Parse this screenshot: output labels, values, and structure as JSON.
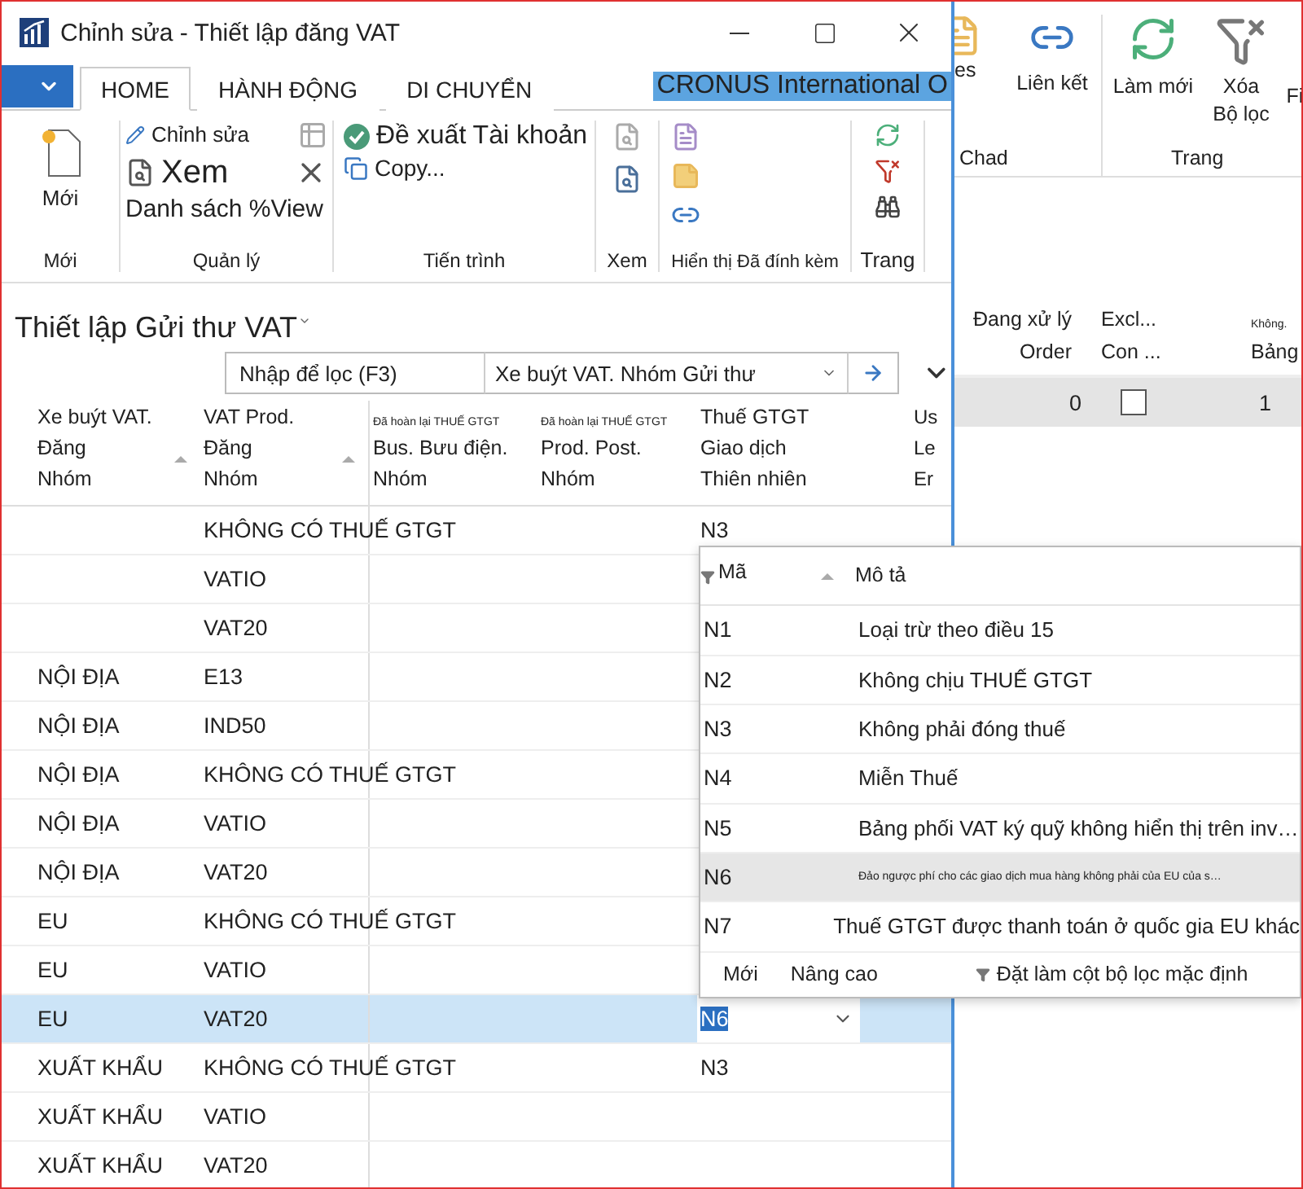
{
  "window": {
    "title": "Chỉnh sửa - Thiết lập đăng VAT"
  },
  "ribbon_tabs": [
    {
      "label": "HOME",
      "selected": true
    },
    {
      "label": "HÀNH ĐỘNG",
      "selected": false
    },
    {
      "label": "DI CHUYỂN",
      "selected": false
    }
  ],
  "company": "CRONUS International O",
  "ribbon": {
    "new": {
      "button": "Mới",
      "group": "Mới"
    },
    "manage": {
      "edit": "Chỉnh sửa",
      "view": "Xem",
      "list": "Danh sách %View",
      "group": "Quản lý"
    },
    "process": {
      "suggest": "Đề xuất Tài khoản",
      "copy": "Copy...",
      "group": "Tiến trình"
    },
    "view_group": "Xem",
    "attachments_group": "Hiển thị Đã đính kèm",
    "page_group": "Trang"
  },
  "page_title": "Thiết lập Gửi thư VAT",
  "filter": {
    "placeholder": "Nhập để lọc (F3)",
    "field": "Xe buýt VAT. Nhóm Gửi thư"
  },
  "columns": [
    {
      "lines": [
        "Xe buýt VAT.",
        "Đăng",
        "Nhóm"
      ],
      "sorted": true
    },
    {
      "lines": [
        "VAT Prod.",
        "Đăng",
        "Nhóm"
      ],
      "sorted": true
    },
    {
      "caption": "Đã hoàn lại THUẾ GTGT",
      "lines": [
        "Bus. Bưu điện.",
        "Nhóm"
      ],
      "sorted": false
    },
    {
      "caption": "Đã hoàn lại THUẾ GTGT",
      "lines": [
        "Prod. Post.",
        "Nhóm"
      ],
      "sorted": false
    },
    {
      "lines": [
        "Thuế GTGT",
        "Giao dịch",
        "Thiên nhiên"
      ],
      "sorted": false
    },
    {
      "lines": [
        "Us",
        "Le",
        "Er"
      ],
      "sorted": false
    }
  ],
  "rows": [
    {
      "bus_group": "",
      "prod_group": "KHÔNG CÓ THUẾ GTGT",
      "vat_nature": "N3",
      "selected": false
    },
    {
      "bus_group": "",
      "prod_group": "VATIO",
      "selected": false
    },
    {
      "bus_group": "",
      "prod_group": "VAT20",
      "selected": false
    },
    {
      "bus_group": "NỘI ĐỊA",
      "prod_group": "E13",
      "selected": false
    },
    {
      "bus_group": "NỘI ĐỊA",
      "prod_group": "IND50",
      "selected": false
    },
    {
      "bus_group": "NỘI ĐỊA",
      "prod_group": "KHÔNG CÓ THUẾ GTGT",
      "selected": false
    },
    {
      "bus_group": "NỘI ĐỊA",
      "prod_group": "VATIO",
      "selected": false
    },
    {
      "bus_group": "NỘI ĐỊA",
      "prod_group": "VAT20",
      "selected": false
    },
    {
      "bus_group": "EU",
      "prod_group": "KHÔNG CÓ THUẾ GTGT",
      "selected": false
    },
    {
      "bus_group": "EU",
      "prod_group": "VATIO",
      "selected": false
    },
    {
      "bus_group": "EU",
      "prod_group": "VAT20",
      "vat_nature": "N6",
      "selected": true
    },
    {
      "bus_group": "XUẤT KHẨU",
      "prod_group": "KHÔNG CÓ THUẾ GTGT",
      "vat_nature": "N3",
      "selected": false
    },
    {
      "bus_group": "XUẤT KHẨU",
      "prod_group": "VATIO",
      "selected": false
    },
    {
      "bus_group": "XUẤT KHẨU",
      "prod_group": "VAT20",
      "selected": false
    }
  ],
  "lookup": {
    "columns": [
      "Mã",
      "Mô tả"
    ],
    "rows": [
      {
        "code": "N1",
        "description": "Loại trừ theo điều 15",
        "kind": "normal",
        "selected": false
      },
      {
        "code": "N2",
        "description": "Không chịu THUẾ GTGT",
        "kind": "normal",
        "selected": false
      },
      {
        "code": "N3",
        "description": "Không phải  đóng thuế",
        "kind": "normal",
        "selected": false
      },
      {
        "code": "N4",
        "description": "Miễn Thuế",
        "kind": "normal",
        "selected": false
      },
      {
        "code": "N5",
        "description": "Bảng phối VAT ký quỹ không hiển thị trên inv…",
        "kind": "normal",
        "selected": false
      },
      {
        "code": "N6",
        "description": "Đảo ngược phí cho các giao dịch mua hàng không phải của EU của s…",
        "kind": "compact",
        "selected": true
      },
      {
        "code": "N7",
        "description": "Thuế GTGT được thanh toán ở quốc gia EU khác",
        "kind": "normal",
        "selected": false
      }
    ],
    "actions": [
      "Mới",
      "Nâng cao"
    ],
    "filter_action": "Đặt làm cột bộ lọc mặc định"
  },
  "background_window": {
    "ribbon_items": [
      "es",
      "Liên kết",
      "Làm mới",
      "Xóa Bộ lọc",
      "Fi"
    ],
    "groups": [
      "Chad",
      "Trang"
    ],
    "columns": [
      {
        "lines": [
          "Đang xử lý",
          "Order"
        ]
      },
      {
        "lines": [
          "Excl...",
          "Con ..."
        ]
      },
      {
        "caption": "Không.",
        "lines": [
          "Bảng"
        ]
      }
    ],
    "row": {
      "value": "0",
      "checked": false,
      "column_3": "1"
    }
  }
}
